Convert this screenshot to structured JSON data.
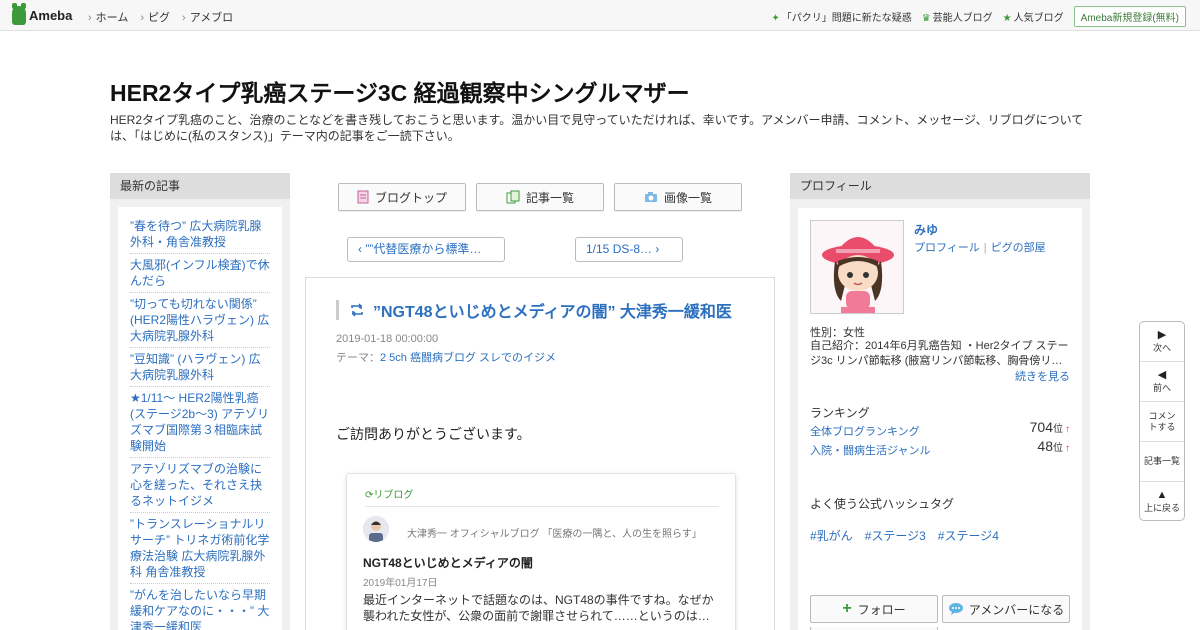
{
  "topbar": {
    "logo_text": "Ameba",
    "nav": [
      "ホーム",
      "ピグ",
      "アメブロ"
    ],
    "news": "「パクリ」問題に新たな疑惑",
    "links": [
      "芸能人ブログ",
      "人気ブログ"
    ],
    "register": "Ameba新規登録(無料)"
  },
  "header": {
    "title": "HER2タイプ乳癌ステージ3C 経過観察中シングルマザー",
    "description": "HER2タイプ乳癌のこと、治療のことなどを書き残しておこうと思います。温かい目で見守っていただければ、幸いです。アメンバー申請、コメント、メッセージ、リブログについては、「はじめに(私のスタンス)」テーマ内の記事をご一読下さい。"
  },
  "sidebar_left": {
    "heading": "最新の記事",
    "items": [
      "”春を待つ” 広大病院乳腺外科・角舎准教授",
      "大風邪(インフル検査)で休んだら",
      "”切っても切れない関係” (HER2陽性ハラヴェン) 広大病院乳腺外科",
      "”豆知識” (ハラヴェン) 広大病院乳腺外科",
      "★1/11～ HER2陽性乳癌(ステージ2b～3) アテゾリズマブ国際第３相臨床試験開始",
      "アテゾリズマブの治験に心を縒った、それさえ抉るネットイジメ",
      "”トランスレーショナルリサーチ” トリネガ術前化学療法治験 広大病院乳腺外科 角舎准教授",
      "”がんを治したいなら早期緩和ケアなのに・・・” 大津秀一緩和医"
    ]
  },
  "tabs": {
    "top": "ブログトップ",
    "list": "記事一覧",
    "images": "画像一覧"
  },
  "pager": {
    "prev": "””代替医療から標準…",
    "next": "1/15 DS-8…"
  },
  "article": {
    "title": "”NGT48といじめとメディアの闇” 大津秀一緩和医",
    "date": "2019-01-18 00:00:00",
    "theme_label": "テーマ：",
    "theme": "2 5ch 癌闘病ブログ スレでのイジメ",
    "greeting": "ご訪問ありがとうございます。",
    "reblog": {
      "label": "リブログ",
      "author": "大津秀一 オフィシャルブログ 「医療の一隅と、人の生を照らす」",
      "title": "NGT48といじめとメディアの闇",
      "date": "2019年01月17日",
      "text": "最近インターネットで話題なのは、NGT48の事件ですね。なぜか襲われた女性が、公衆の面前で謝罪させられて……というのは…"
    }
  },
  "profile": {
    "heading": "プロフィール",
    "name": "みゆ",
    "link_profile": "プロフィール",
    "link_pig": "ピグの部屋",
    "gender": "性別：女性",
    "intro": "自己紹介：2014年6月乳癌告知 ・Her2タイプ ステージ3c リンパ節転移 (腋窩リンパ節転移、胸骨傍リ…",
    "more": "続きを見る",
    "ranking_heading": "ランキング",
    "rankings": [
      {
        "label": "全体ブログランキング",
        "value": "704",
        "unit": "位",
        "arrow": "↑"
      },
      {
        "label": "入院・闘病生活ジャンル",
        "value": "48",
        "unit": "位",
        "arrow": "↑"
      }
    ],
    "hashtag_heading": "よく使う公式ハッシュタグ",
    "hashtags": [
      "#乳がん",
      "#ステージ3",
      "#ステージ4"
    ],
    "follow": "フォロー",
    "member": "アメンバーになる"
  },
  "sidenav": {
    "next": "次へ",
    "prev": "前へ",
    "comment": "コメントする",
    "list": "記事一覧",
    "top": "上に戻る"
  },
  "colors": {
    "ameba_green": "#3d9a3a",
    "link_blue": "#2c6fbf"
  }
}
